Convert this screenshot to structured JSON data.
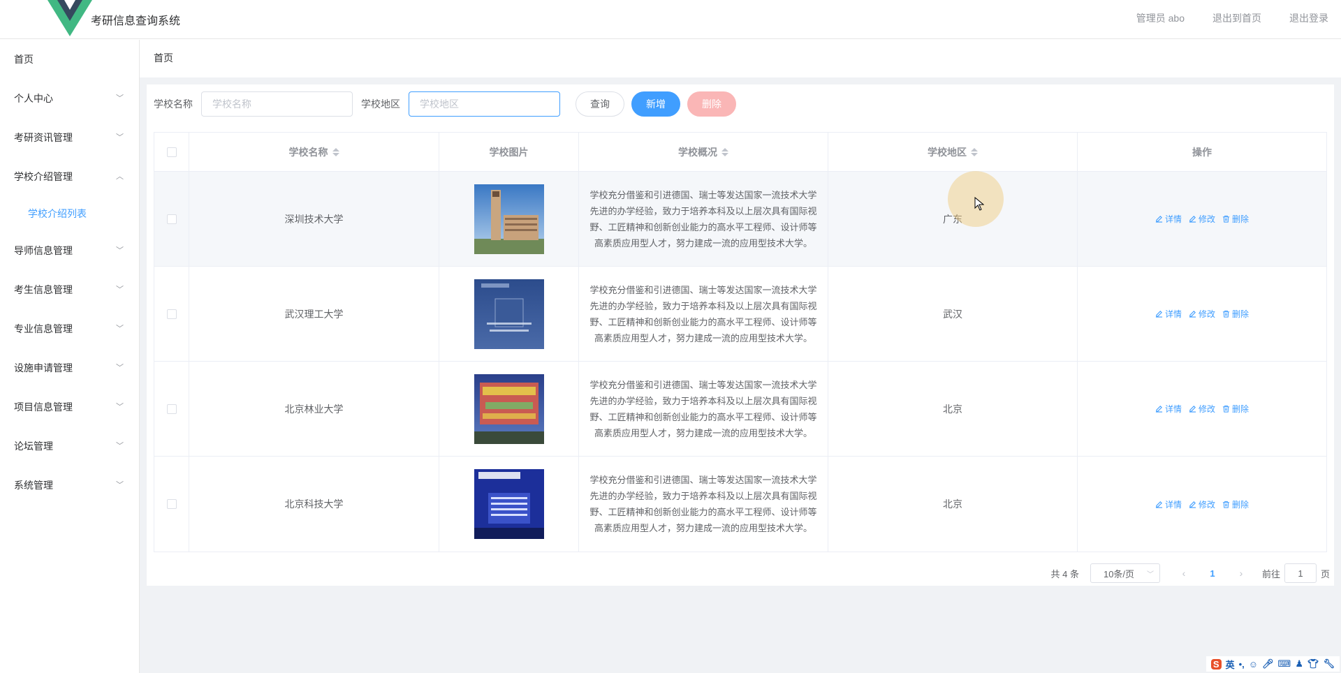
{
  "header": {
    "title": "考研信息查询系统",
    "links": [
      "管理员 abo",
      "退出到首页",
      "退出登录"
    ]
  },
  "sidebar": {
    "items": [
      {
        "label": "首页"
      },
      {
        "label": "个人中心"
      },
      {
        "label": "考研资讯管理"
      },
      {
        "label": "学校介绍管理"
      },
      {
        "label": "导师信息管理"
      },
      {
        "label": "考生信息管理"
      },
      {
        "label": "专业信息管理"
      },
      {
        "label": "设施申请管理"
      },
      {
        "label": "项目信息管理"
      },
      {
        "label": "论坛管理"
      },
      {
        "label": "系统管理"
      }
    ],
    "submenu": {
      "label": "学校介绍列表"
    }
  },
  "breadcrumb": "首页",
  "search": {
    "name_label": "学校名称",
    "name_placeholder": "学校名称",
    "region_label": "学校地区",
    "region_placeholder": "学校地区",
    "query_btn": "查询",
    "add_btn": "新增",
    "delete_btn": "删除"
  },
  "table": {
    "headers": {
      "name": "学校名称",
      "image": "学校图片",
      "overview": "学校概况",
      "region": "学校地区",
      "actions": "操作"
    },
    "action_labels": {
      "detail": "详情",
      "edit": "修改",
      "delete": "删除"
    },
    "rows": [
      {
        "name": "深圳技术大学",
        "overview": "学校充分借鉴和引进德国、瑞士等发达国家一流技术大学先进的办学经验，致力于培养本科及以上层次具有国际视野、工匠精神和创新创业能力的高水平工程师、设计师等高素质应用型人才，努力建成一流的应用型技术大学。",
        "region": "广东"
      },
      {
        "name": "武汉理工大学",
        "overview": "学校充分借鉴和引进德国、瑞士等发达国家一流技术大学先进的办学经验，致力于培养本科及以上层次具有国际视野、工匠精神和创新创业能力的高水平工程师、设计师等高素质应用型人才，努力建成一流的应用型技术大学。",
        "region": "武汉"
      },
      {
        "name": "北京林业大学",
        "overview": "学校充分借鉴和引进德国、瑞士等发达国家一流技术大学先进的办学经验，致力于培养本科及以上层次具有国际视野、工匠精神和创新创业能力的高水平工程师、设计师等高素质应用型人才，努力建成一流的应用型技术大学。",
        "region": "北京"
      },
      {
        "name": "北京科技大学",
        "overview": "学校充分借鉴和引进德国、瑞士等发达国家一流技术大学先进的办学经验，致力于培养本科及以上层次具有国际视野、工匠精神和创新创业能力的高水平工程师、设计师等高素质应用型人才，努力建成一流的应用型技术大学。",
        "region": "北京"
      }
    ]
  },
  "pagination": {
    "total": "共 4 条",
    "page_size": "10条/页",
    "current_page": "1",
    "goto_label": "前往",
    "goto_value": "1",
    "page_suffix": "页"
  },
  "ime": {
    "lang": "英"
  },
  "colors": {
    "primary": "#409eff",
    "danger_disabled": "#fab6b6",
    "bg": "#f0f2f5"
  }
}
